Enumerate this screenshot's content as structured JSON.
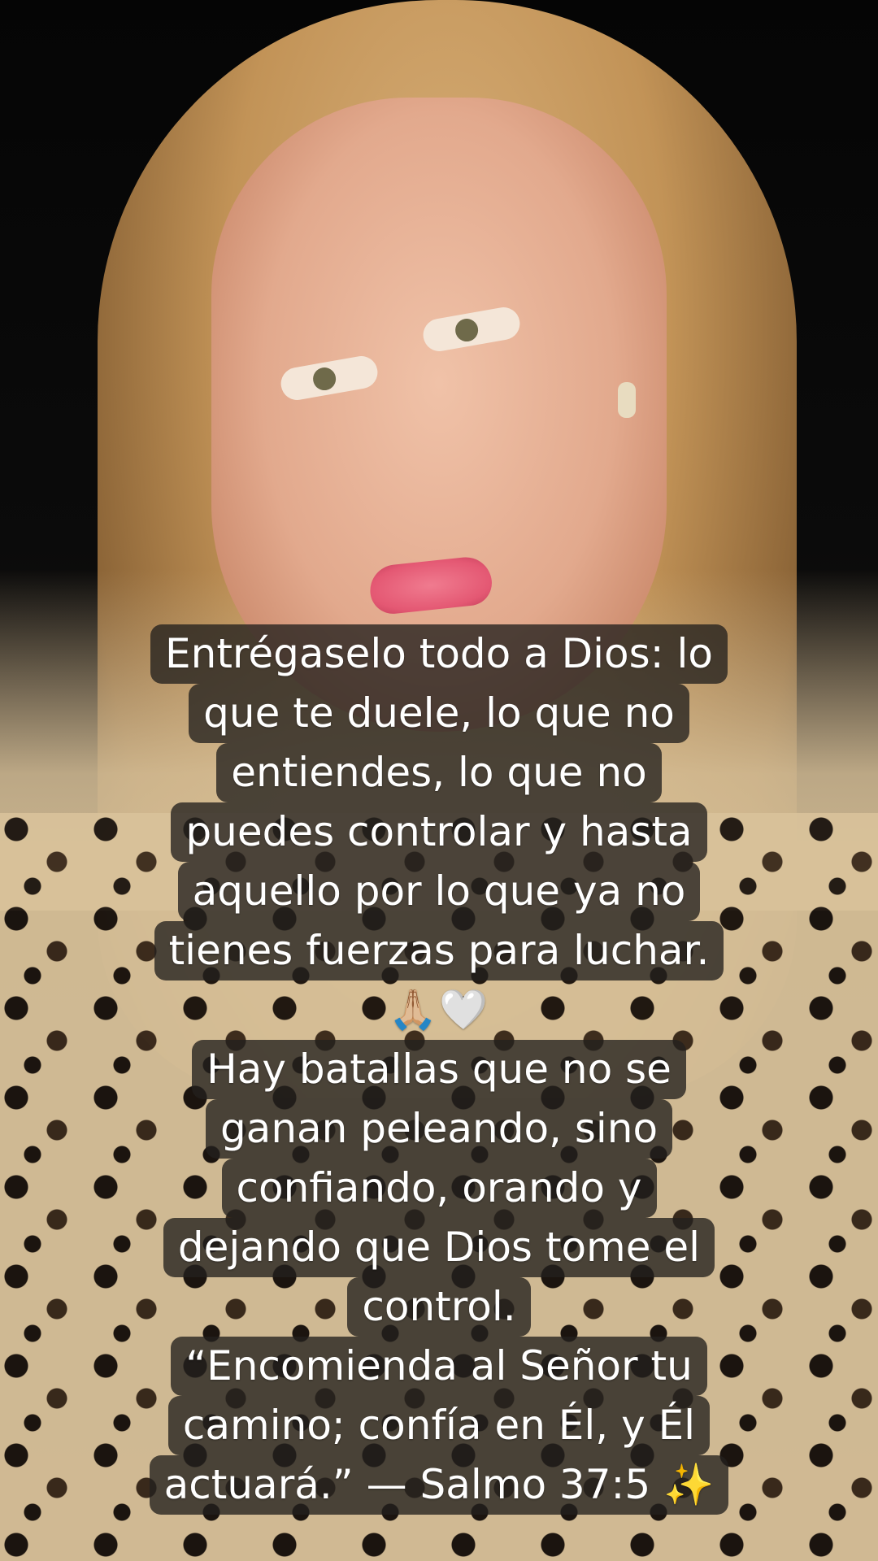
{
  "caption": {
    "lines": [
      "Entrégaselo todo a Dios: lo",
      "que te duele, lo que no",
      "entiendes, lo que no",
      "puedes controlar y hasta",
      "aquello por lo que ya no",
      "tienes fuerzas para luchar.",
      "🙏🏼🤍",
      "Hay batallas que no se",
      "ganan peleando, sino",
      "confiando, orando y",
      "dejando que Dios tome el",
      "control.",
      "“Encomienda al Señor tu",
      "camino; confía en Él, y Él",
      "actuará.” — Salmo 37:5 ✨"
    ]
  },
  "colors": {
    "caption_background": "#23201e",
    "caption_text": "#ffffff"
  }
}
